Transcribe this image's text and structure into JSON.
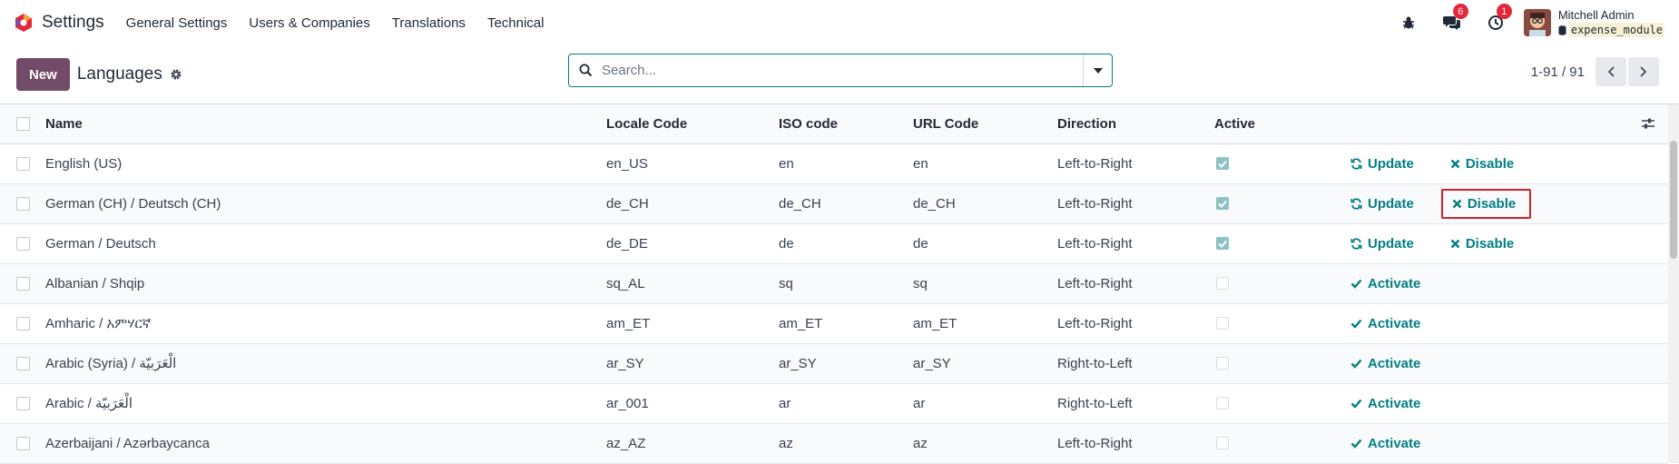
{
  "navbar": {
    "app_name": "Settings",
    "menu": [
      "General Settings",
      "Users & Companies",
      "Translations",
      "Technical"
    ],
    "messages_count": "6",
    "activities_count": "1",
    "user_name": "Mitchell Admin",
    "database": "expense_module"
  },
  "control": {
    "new_label": "New",
    "title": "Languages",
    "search_placeholder": "Search...",
    "pager": "1-91 / 91"
  },
  "table": {
    "columns": [
      "Name",
      "Locale Code",
      "ISO code",
      "URL Code",
      "Direction",
      "Active"
    ],
    "rows": [
      {
        "name": "English (US)",
        "locale": "en_US",
        "iso": "en",
        "url": "en",
        "direction": "Left-to-Right",
        "active": true
      },
      {
        "name": "German (CH) / Deutsch (CH)",
        "locale": "de_CH",
        "iso": "de_CH",
        "url": "de_CH",
        "direction": "Left-to-Right",
        "active": true
      },
      {
        "name": "German / Deutsch",
        "locale": "de_DE",
        "iso": "de",
        "url": "de",
        "direction": "Left-to-Right",
        "active": true
      },
      {
        "name": "Albanian / Shqip",
        "locale": "sq_AL",
        "iso": "sq",
        "url": "sq",
        "direction": "Left-to-Right",
        "active": false
      },
      {
        "name": "Amharic / አምሃርኛ",
        "locale": "am_ET",
        "iso": "am_ET",
        "url": "am_ET",
        "direction": "Left-to-Right",
        "active": false
      },
      {
        "name": "Arabic (Syria) / الْعَرَبيّة",
        "locale": "ar_SY",
        "iso": "ar_SY",
        "url": "ar_SY",
        "direction": "Right-to-Left",
        "active": false
      },
      {
        "name": "Arabic / الْعَرَبيّة",
        "locale": "ar_001",
        "iso": "ar",
        "url": "ar",
        "direction": "Right-to-Left",
        "active": false
      },
      {
        "name": "Azerbaijani / Azərbaycanca",
        "locale": "az_AZ",
        "iso": "az",
        "url": "az",
        "direction": "Left-to-Right",
        "active": false
      }
    ],
    "update_label": "Update",
    "disable_label": "Disable",
    "activate_label": "Activate"
  },
  "colors": {
    "brand": "#714b67",
    "action": "#017e84",
    "highlight": "#d61f2c",
    "badge": "#e5273c"
  }
}
